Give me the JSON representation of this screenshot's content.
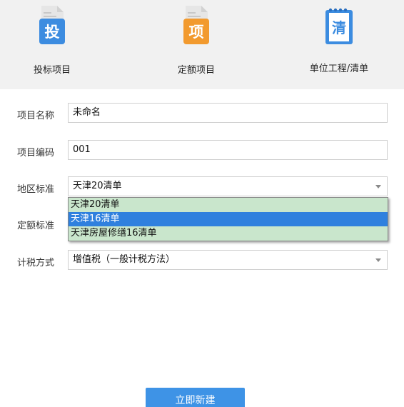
{
  "modes": [
    {
      "label": "投标项目",
      "icon_char": "投",
      "icon_color": "#3c8ce0"
    },
    {
      "label": "定额项目",
      "icon_char": "项",
      "icon_color": "#f29a2e"
    },
    {
      "label": "单位工程/清单",
      "icon_char": "清",
      "icon_color": "#3c8ce0"
    }
  ],
  "form": {
    "project_name": {
      "label": "项目名称",
      "value": "未命名"
    },
    "project_code": {
      "label": "项目编码",
      "value": "001"
    },
    "region_standard": {
      "label": "地区标准",
      "value": "天津20清单"
    },
    "quota_standard": {
      "label": "定额标准"
    },
    "tax_method": {
      "label": "计税方式",
      "value": "增值税（一般计税方法）"
    }
  },
  "region_dropdown": {
    "options": [
      "天津20清单",
      "天津16清单",
      "天津房屋修缮16清单"
    ],
    "highlighted": "天津16清单"
  },
  "create_button": {
    "label": "立即新建"
  },
  "colors": {
    "accent": "#3e93e6",
    "dropdown_bg": "#c9e6cc",
    "highlight": "#2f80de"
  }
}
